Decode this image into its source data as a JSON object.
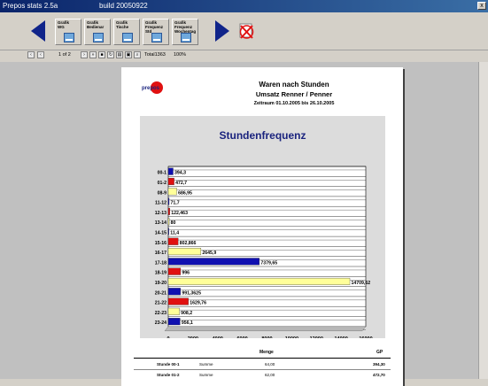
{
  "window": {
    "app_title": "Prepos stats 2.5a",
    "build": "build 20050922",
    "close_glyph": "x"
  },
  "toolbar": {
    "buttons": [
      {
        "label": "Grafik\nWG"
      },
      {
        "label": "Grafik\nBedienar"
      },
      {
        "label": "Grafik\nTische"
      },
      {
        "label": "Grafik\nFrequenz\nStd"
      },
      {
        "label": "Grafik\nFrequenz\nWochentag"
      }
    ]
  },
  "pager": {
    "page": "1 of 2",
    "total": "Total1363",
    "zoom": "100%"
  },
  "report": {
    "logo_text": "prepos",
    "title": "Waren nach Stunden",
    "subtitle": "Umsatz Renner / Penner",
    "period": "Zeitraum   01.10.2005  bis  26.10.2005",
    "col_menge": "Menge",
    "col_gp": "GP",
    "rows": [
      {
        "stunde": "Stunde  00-1",
        "summe": "Summe",
        "menge": "64,00",
        "gp": "394,30"
      },
      {
        "stunde": "Stunde  01-2",
        "summe": "Summe",
        "menge": "62,00",
        "gp": "472,70"
      }
    ]
  },
  "chart_data": {
    "type": "bar",
    "orientation": "horizontal",
    "title": "Stundenfrequenz",
    "categories": [
      "00-1",
      "01-2",
      "08-9",
      "11-12",
      "12-13",
      "13-14",
      "14-15",
      "15-16",
      "16-17",
      "17-18",
      "18-19",
      "19-20",
      "20-21",
      "21-22",
      "22-23",
      "23-24"
    ],
    "values": [
      394.3,
      472.7,
      686.95,
      71.7,
      122.463,
      80,
      11.4,
      802.866,
      2645.9,
      7379.65,
      996,
      14709.62,
      991.3625,
      1629.76,
      908.2,
      956.1
    ],
    "value_labels": [
      "394,3",
      "472,7",
      "686,95",
      "71,7",
      "122,463",
      "80",
      "11,4",
      "802,866",
      "2645,9",
      "7379,65",
      "996",
      "14709,62",
      "991,3625",
      "1629,76",
      "908,2",
      "956,1"
    ],
    "bar_colors": [
      "#1010b0",
      "#e01010",
      "#ffff99",
      "#1010b0",
      "#e01010",
      "#ffff99",
      "#1010b0",
      "#e01010",
      "#ffff99",
      "#1010b0",
      "#e01010",
      "#ffff99",
      "#1010b0",
      "#e01010",
      "#ffff99",
      "#1010b0"
    ],
    "x_ticks": [
      0,
      2000,
      4000,
      6000,
      8000,
      10000,
      12000,
      14000,
      16000
    ],
    "xlim": [
      0,
      16000
    ],
    "grid": true
  }
}
